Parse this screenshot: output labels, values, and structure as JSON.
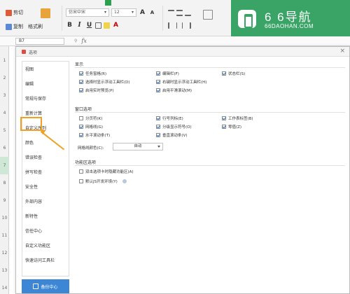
{
  "ribbon": {
    "cut_label": "剪切",
    "copy_label": "复制",
    "format_painter_label": "格式刷",
    "paste_label": "粘贴",
    "font_name": "仿宋中宋",
    "font_size": "12"
  },
  "logo": {
    "big": "6 6导航",
    "small": "66DAOHAN.COM"
  },
  "formula_bar": {
    "cell_ref": "B7",
    "fx": "fx"
  },
  "rows": [
    "1",
    "2",
    "3",
    "4",
    "5",
    "6",
    "7",
    "8",
    "9",
    "10",
    "11",
    "12",
    "13",
    "14"
  ],
  "dialog": {
    "title": "选项",
    "close": "×",
    "nav": [
      "视图",
      "编辑",
      "常规与保存",
      "重新计算",
      "自定义序列",
      "颜色",
      "错误检查",
      "拼写检查",
      "安全性",
      "外部内容",
      "新特性",
      "信任中心",
      "自定义功能区",
      "快速访问工具栏"
    ],
    "backup_label": "备份中心",
    "display": {
      "title": "显示",
      "options": [
        {
          "label": "任务窗格(R)",
          "checked": true
        },
        {
          "label": "编辑栏(F)",
          "checked": true
        },
        {
          "label": "状态栏(S)",
          "checked": true
        },
        {
          "label": "选择时显示浮动工具栏(D)",
          "checked": true
        },
        {
          "label": "右键时显示浮动工具栏(H)",
          "checked": true
        },
        {
          "label": "启用实时预览(P)",
          "checked": true
        },
        {
          "label": "启用平滑滚动(M)",
          "checked": true
        }
      ]
    },
    "window": {
      "title": "窗口选项",
      "options": [
        {
          "label": "分页符(K)",
          "checked": false
        },
        {
          "label": "行号列标(E)",
          "checked": true
        },
        {
          "label": "工作表标签(B)",
          "checked": true
        },
        {
          "label": "网格线(G)",
          "checked": true
        },
        {
          "label": "分级显示符号(O)",
          "checked": true
        },
        {
          "label": "零值(Z)",
          "checked": true
        },
        {
          "label": "水平滚动条(T)",
          "checked": true
        },
        {
          "label": "垂直滚动条(V)",
          "checked": true
        }
      ],
      "gridcolor_label": "网格线颜色(C):",
      "gridcolor_value": "自动"
    },
    "ribbon_opts": {
      "title": "功能区选项",
      "options": [
        {
          "label": "双击选项卡时隐藏功能区(A)",
          "checked": false
        },
        {
          "label": "默认JS开发环境(Y)",
          "checked": false
        }
      ]
    }
  }
}
